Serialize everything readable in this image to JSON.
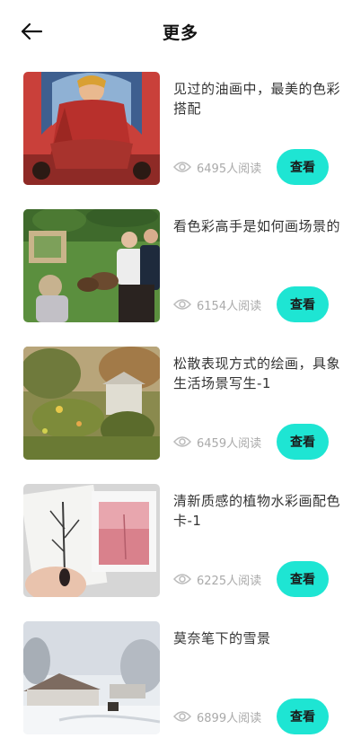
{
  "header": {
    "back_icon": "arrow-left-icon",
    "title": "更多"
  },
  "colors": {
    "accent": "#1ee5d3",
    "muted_text": "#aaaaaa"
  },
  "articles": [
    {
      "title": "见过的油画中，最美的色彩搭配",
      "reads": "6495人阅读",
      "button": "查看"
    },
    {
      "title": "看色彩高手是如何画场景的",
      "reads": "6154人阅读",
      "button": "查看"
    },
    {
      "title": "松散表现方式的绘画，具象生活场景写生-1",
      "reads": "6459人阅读",
      "button": "查看"
    },
    {
      "title": "清新质感的植物水彩画配色卡-1",
      "reads": "6225人阅读",
      "button": "查看"
    },
    {
      "title": "莫奈笔下的雪景",
      "reads": "6899人阅读",
      "button": "查看"
    }
  ]
}
